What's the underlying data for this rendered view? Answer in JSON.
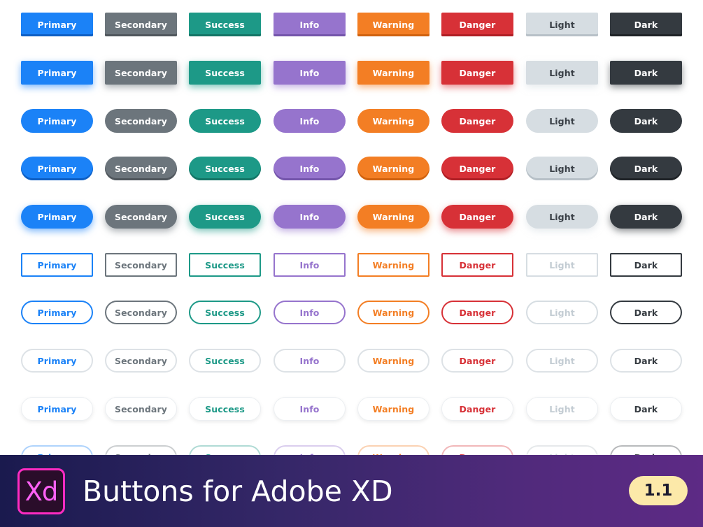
{
  "variants": [
    {
      "key": "primary",
      "label": "Primary",
      "color": "#1b82f7",
      "dark": "#0e5fc4",
      "text": "#1b82f7"
    },
    {
      "key": "secondary",
      "label": "Secondary",
      "color": "#6c757c",
      "dark": "#4f565c",
      "text": "#6c757c"
    },
    {
      "key": "success",
      "label": "Success",
      "color": "#1d9987",
      "dark": "#147566",
      "text": "#1d9987"
    },
    {
      "key": "info",
      "label": "Info",
      "color": "#9674cd",
      "dark": "#7455ab",
      "text": "#9674cd"
    },
    {
      "key": "warning",
      "label": "Warning",
      "color": "#f37e24",
      "dark": "#d0620f",
      "text": "#f37e24"
    },
    {
      "key": "danger",
      "label": "Danger",
      "color": "#d73137",
      "dark": "#b01f25",
      "text": "#d73137"
    },
    {
      "key": "light",
      "label": "Light",
      "color": "#d6dde2",
      "dark": "#b7c0c7",
      "text": "#c3ccd3",
      "label_color": "#3a4047"
    },
    {
      "key": "dark",
      "label": "Dark",
      "color": "#343a40",
      "dark": "#1f2327",
      "text": "#343a40"
    }
  ],
  "rows": [
    {
      "style": "solid-square-3d"
    },
    {
      "style": "solid-square-glow"
    },
    {
      "style": "solid-pill"
    },
    {
      "style": "solid-pill-3d"
    },
    {
      "style": "solid-pill-glow"
    },
    {
      "style": "outline-square"
    },
    {
      "style": "outline-pill"
    },
    {
      "style": "ghost-pill-grey-border"
    },
    {
      "style": "ghost-pill-shadow"
    },
    {
      "style": "outline-pill-faint"
    }
  ],
  "banner": {
    "logo_text": "Xd",
    "title": "Buttons for Adobe XD",
    "version": "1.1"
  }
}
